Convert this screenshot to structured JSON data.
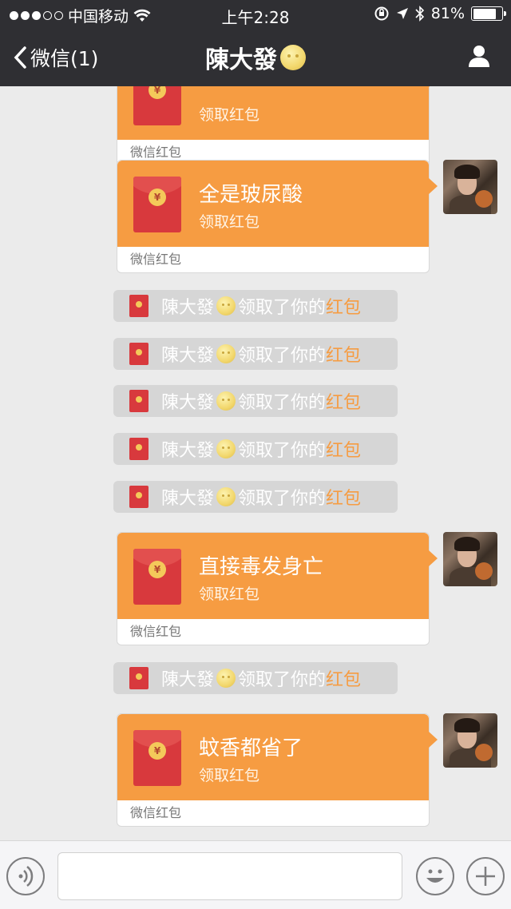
{
  "status_bar": {
    "carrier": "中国移动",
    "time": "上午2:28",
    "battery": "81%"
  },
  "nav": {
    "back_label": "微信(1)",
    "title": "陳大發"
  },
  "redpackets": [
    {
      "message": "",
      "action": "领取红包",
      "footer": "微信红包"
    },
    {
      "message": "全是玻尿酸",
      "action": "领取红包",
      "footer": "微信红包"
    },
    {
      "message": "直接毒发身亡",
      "action": "领取红包",
      "footer": "微信红包"
    },
    {
      "message": "蚊香都省了",
      "action": "领取红包",
      "footer": "微信红包"
    }
  ],
  "system_notice": {
    "name": "陳大發",
    "text": "领取了你的",
    "link": "红包"
  },
  "colors": {
    "accent": "#f69c42",
    "nav_bg": "#2f2f33",
    "chat_bg": "#ebebeb",
    "envelope_red": "#d8393d"
  }
}
